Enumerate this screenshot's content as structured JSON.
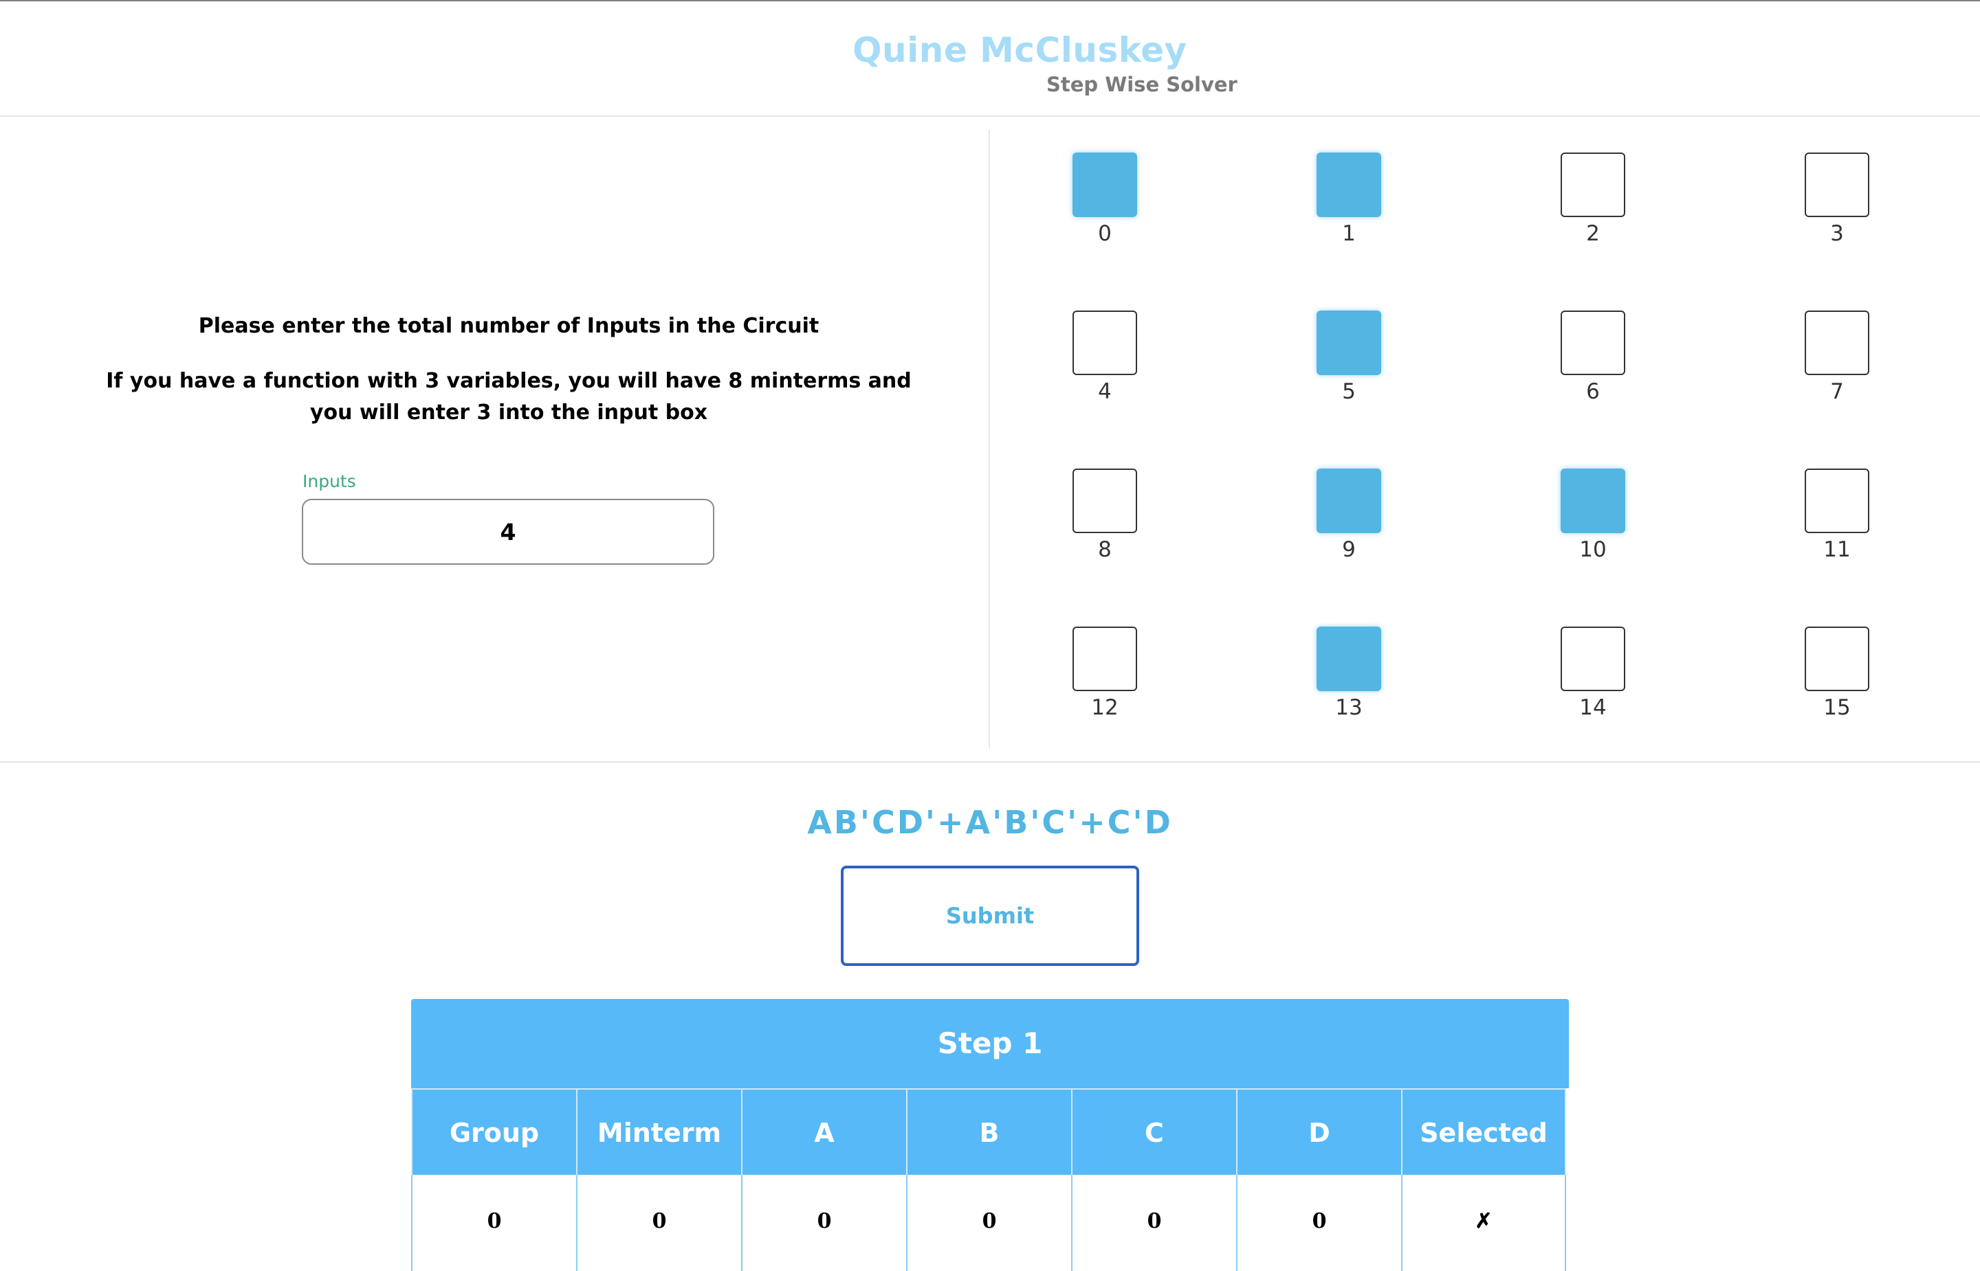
{
  "header": {
    "title": "Quine McCluskey",
    "subtitle": "Step Wise Solver"
  },
  "instructions": {
    "line1": "Please enter the total number of Inputs in the Circuit",
    "line2": "If you have a function with 3 variables, you will have 8 minterms and you will enter 3 into the input box"
  },
  "inputs": {
    "label": "Inputs",
    "value": "4"
  },
  "minterms": [
    {
      "label": "0",
      "selected": true
    },
    {
      "label": "1",
      "selected": true
    },
    {
      "label": "2",
      "selected": false
    },
    {
      "label": "3",
      "selected": false
    },
    {
      "label": "4",
      "selected": false
    },
    {
      "label": "5",
      "selected": true
    },
    {
      "label": "6",
      "selected": false
    },
    {
      "label": "7",
      "selected": false
    },
    {
      "label": "8",
      "selected": false
    },
    {
      "label": "9",
      "selected": true
    },
    {
      "label": "10",
      "selected": true
    },
    {
      "label": "11",
      "selected": false
    },
    {
      "label": "12",
      "selected": false
    },
    {
      "label": "13",
      "selected": true
    },
    {
      "label": "14",
      "selected": false
    },
    {
      "label": "15",
      "selected": false
    }
  ],
  "result": {
    "expression": "AB'CD'+A'B'C'+C'D"
  },
  "submit_label": "Submit",
  "step_table": {
    "title": "Step 1",
    "columns": [
      "Group",
      "Minterm",
      "A",
      "B",
      "C",
      "D",
      "Selected"
    ],
    "rows": [
      [
        "0",
        "0",
        "0",
        "0",
        "0",
        "0",
        "✗"
      ]
    ]
  },
  "colors": {
    "accent": "#53b5e2",
    "table_header": "#57b9f7",
    "title": "#a6dcf7",
    "submit_border": "#2b63c4",
    "inputs_label": "#3aa882"
  }
}
